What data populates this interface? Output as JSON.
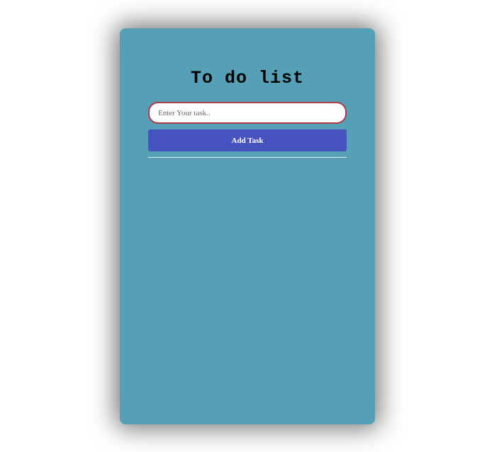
{
  "app": {
    "title": "To do list"
  },
  "form": {
    "input_value": "",
    "input_placeholder": "Enter Your task..",
    "add_button_label": "Add Task"
  },
  "tasks": [],
  "colors": {
    "card_background": "#55a0b6",
    "button_background": "#4652bd",
    "input_border": "#b03a45"
  }
}
